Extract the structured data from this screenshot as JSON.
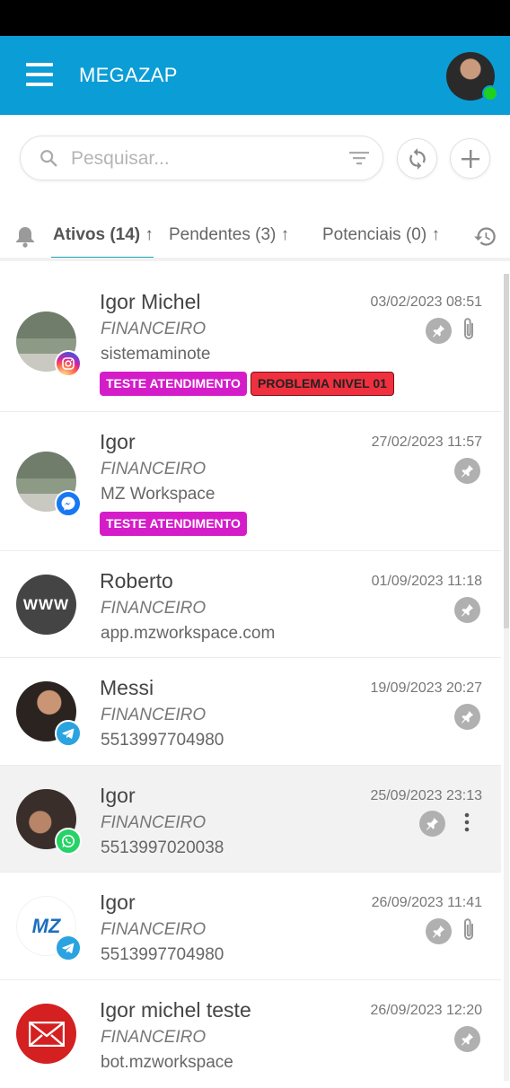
{
  "app": {
    "title": "MEGAZAP"
  },
  "search": {
    "placeholder": "Pesquisar..."
  },
  "tabs": [
    {
      "label": "Ativos (14)",
      "arrow": "↑"
    },
    {
      "label": "Pendentes (3)",
      "arrow": "↑"
    },
    {
      "label": "Potenciais (0)",
      "arrow": "↑"
    }
  ],
  "conversations": [
    {
      "name": "Igor Michel",
      "queue": "FINANCEIRO",
      "subtitle": "sistemaminote",
      "date": "03/02/2023 08:51",
      "channel": "instagram-icon",
      "tags": [
        "TESTE ATENDIMENTO",
        "PROBLEMA NIVEL 01"
      ]
    },
    {
      "name": "Igor",
      "queue": "FINANCEIRO",
      "subtitle": "MZ Workspace",
      "date": "27/02/2023 11:57",
      "channel": "messenger-icon",
      "tags": [
        "TESTE ATENDIMENTO"
      ]
    },
    {
      "name": "Roberto",
      "queue": "FINANCEIRO",
      "subtitle": "app.mzworkspace.com",
      "date": "01/09/2023 11:18",
      "channel": "",
      "avatar_text": "WWW"
    },
    {
      "name": "Messi",
      "queue": "FINANCEIRO",
      "subtitle": "5513997704980",
      "date": "19/09/2023 20:27",
      "channel": "telegram-icon"
    },
    {
      "name": "Igor",
      "queue": "FINANCEIRO",
      "subtitle": "5513997020038",
      "date": "25/09/2023 23:13",
      "channel": "whatsapp-icon"
    },
    {
      "name": "Igor",
      "queue": "FINANCEIRO",
      "subtitle": "5513997704980",
      "date": "26/09/2023 11:41",
      "channel": "telegram-icon",
      "avatar_text": "MZ"
    },
    {
      "name": "Igor michel teste",
      "queue": "FINANCEIRO",
      "subtitle": "bot.mzworkspace",
      "date": "26/09/2023 12:20",
      "channel": ""
    }
  ],
  "colors": {
    "appbar": "#0b9dd6",
    "online": "#1ed11e",
    "tag_pink": "#d41dc9",
    "tag_red": "#f0303f",
    "tab_accent": "#17a6b4"
  }
}
